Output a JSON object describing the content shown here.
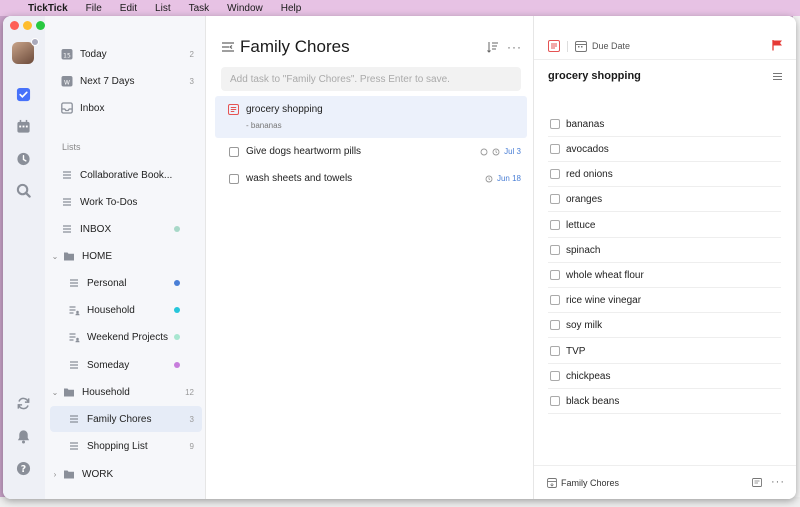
{
  "menubar": {
    "app": "TickTick",
    "items": [
      "File",
      "Edit",
      "List",
      "Task",
      "Window",
      "Help"
    ]
  },
  "colors": {
    "accent": "#4772fa",
    "active_bg": "#e6ecf7",
    "flag": "#e53935",
    "due": "#4a7fd6"
  },
  "sidebar": {
    "smart": [
      {
        "label": "Today",
        "count": "2",
        "icon": "calendar-day-icon"
      },
      {
        "label": "Next 7 Days",
        "count": "3",
        "icon": "calendar-week-icon"
      },
      {
        "label": "Inbox",
        "count": "",
        "icon": "inbox-icon"
      }
    ],
    "section_label": "Lists",
    "lists": [
      {
        "label": "Collaborative Book...",
        "dot": ""
      },
      {
        "label": "Work To-Dos",
        "dot": ""
      },
      {
        "label": "INBOX",
        "dot": "#a8d8c8"
      },
      {
        "label": "HOME",
        "folder": true
      },
      {
        "label": "Personal",
        "dot": "#4a7fd6"
      },
      {
        "label": "Household",
        "dot": "#26c6da"
      },
      {
        "label": "Weekend Projects",
        "dot": "#a8e6d0"
      },
      {
        "label": "Someday",
        "dot": "#c77ddc"
      },
      {
        "label": "Household",
        "folder": true,
        "count": "12"
      },
      {
        "label": "Family Chores",
        "count": "3",
        "active": true
      },
      {
        "label": "Shopping List",
        "count": "9"
      },
      {
        "label": "WORK",
        "folder": true,
        "collapsed": true
      }
    ]
  },
  "tasks": {
    "title": "Family Chores",
    "add_placeholder": "Add task to \"Family Chores\". Press Enter to save.",
    "items": [
      {
        "title": "grocery shopping",
        "subtitle": "- bananas",
        "type": "note"
      },
      {
        "title": "Give dogs heartworm pills",
        "due": "Jul 3"
      },
      {
        "title": "wash sheets and towels",
        "due": "Jun 18"
      }
    ]
  },
  "detail": {
    "due_label": "Due Date",
    "title": "grocery shopping",
    "checklist": [
      "bananas",
      "avocados",
      "red onions",
      "oranges",
      "lettuce",
      "spinach",
      "whole wheat flour",
      "rice wine vinegar",
      "soy milk",
      "TVP",
      "chickpeas",
      "black beans"
    ],
    "footer_list": "Family Chores"
  }
}
